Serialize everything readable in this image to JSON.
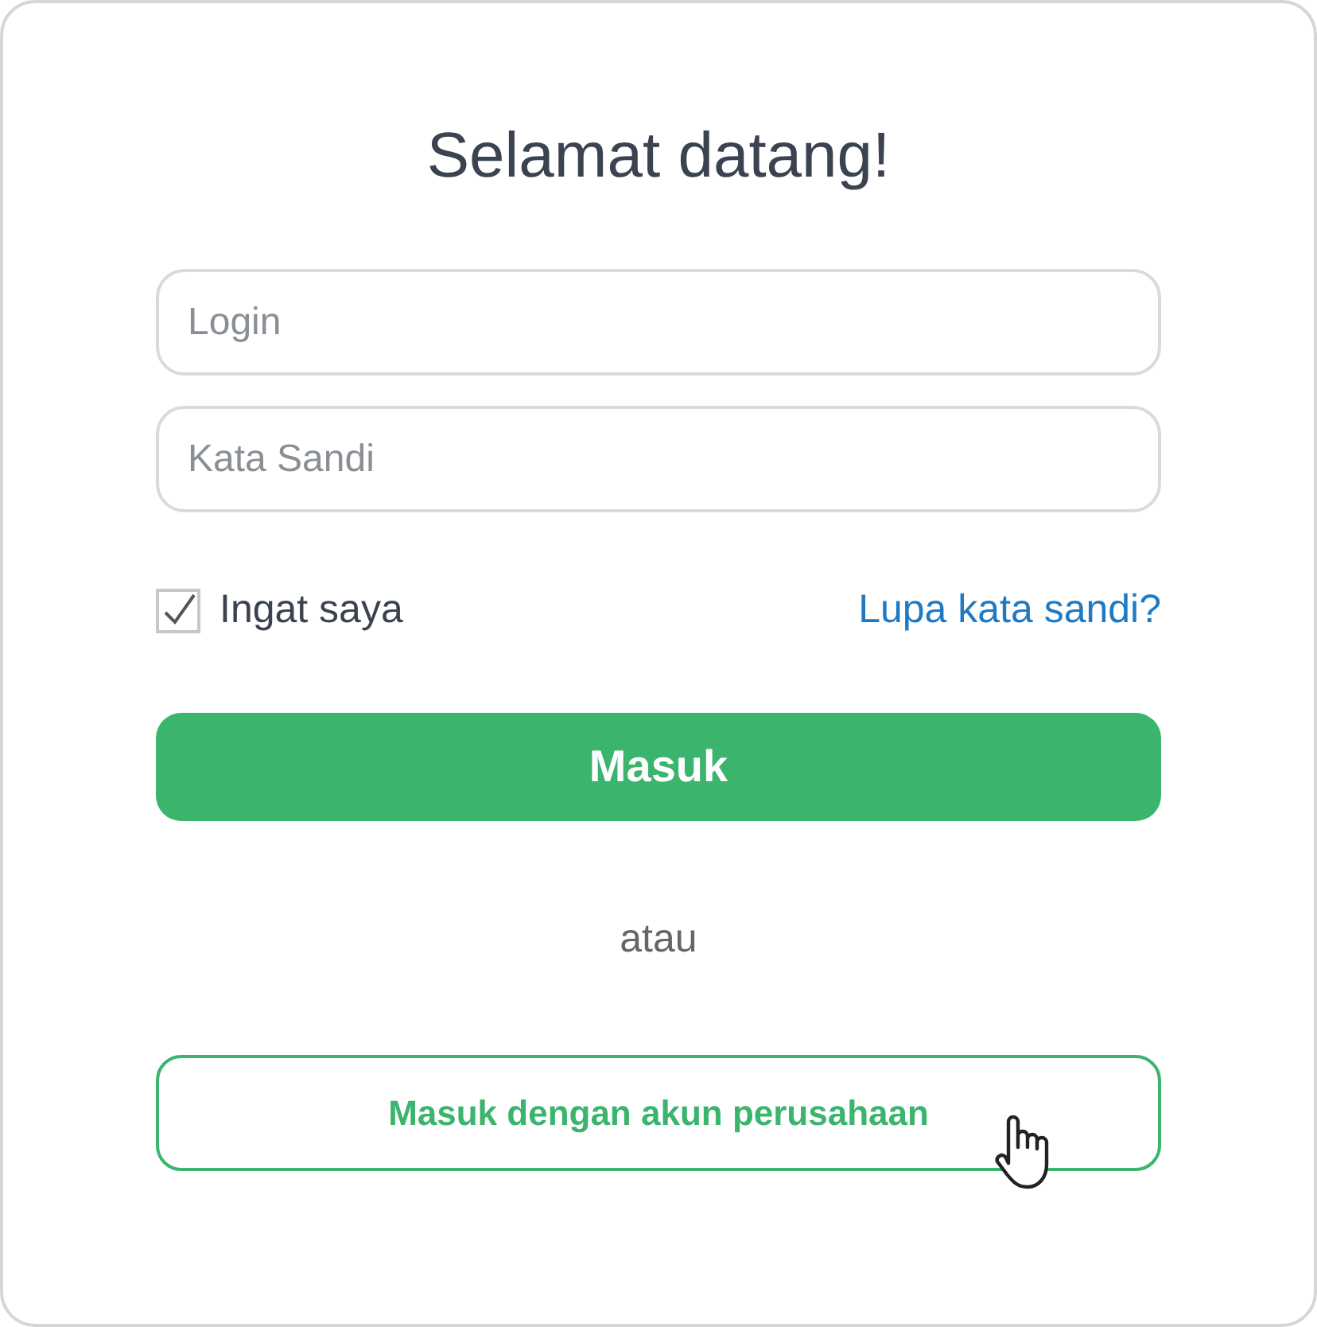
{
  "title": "Selamat datang!",
  "fields": [
    {
      "placeholder": "Login"
    },
    {
      "placeholder": "Kata Sandi"
    }
  ],
  "remember": {
    "label": "Ingat saya",
    "checked": true
  },
  "forgot_link": "Lupa kata sandi?",
  "submit_button": "Masuk",
  "separator": "atau",
  "corporate_button": "Masuk dengan akun perusahaan"
}
